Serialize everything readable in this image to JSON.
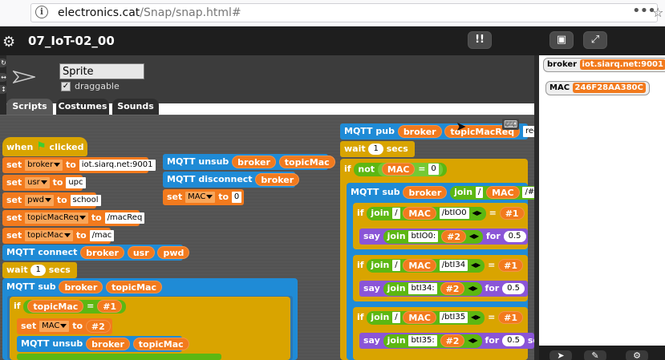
{
  "browser": {
    "url_host": "electronics.cat",
    "url_path": "/Snap/snap.html#",
    "menu_glyph": "•••",
    "star_glyph": "☆"
  },
  "toolbar": {
    "project_title": "07_IoT-02_00",
    "gear_glyph": "⚙",
    "cloud_glyph": "!!",
    "stage_glyph": "▣",
    "fullscreen_glyph": "⤢"
  },
  "palette_controls": [
    "↻",
    "↔",
    "↕"
  ],
  "sprite": {
    "name": "Sprite",
    "draggable_label": "draggable",
    "draggable_checked": "✓"
  },
  "tabs": [
    "Scripts",
    "Costumes",
    "Sounds"
  ],
  "scripts": {
    "hat": {
      "when": "when",
      "clicked": "clicked"
    },
    "set_label": "set",
    "to_label": "to",
    "sets": [
      {
        "var": "broker",
        "value": "iot.siarq.net:9001"
      },
      {
        "var": "usr",
        "value": "upc"
      },
      {
        "var": "pwd",
        "value": "school"
      },
      {
        "var": "topicMacReq",
        "value": "/macReq"
      },
      {
        "var": "topicMac",
        "value": "/mac"
      }
    ],
    "connect": {
      "label": "MQTT connect",
      "args": [
        "broker",
        "usr",
        "pwd"
      ]
    },
    "wait": {
      "label": "wait",
      "value": "1",
      "unit": "secs"
    },
    "sub": {
      "label": "MQTT sub",
      "args": [
        "broker",
        "topicMac"
      ]
    },
    "if_label": "if",
    "eq": "=",
    "if1": {
      "var": "topicMac",
      "value": "#1"
    },
    "set_mac": {
      "var": "MAC",
      "value": "#2"
    },
    "unsub_inner": {
      "label": "MQTT unsub",
      "args": [
        "broker",
        "topicMac"
      ]
    },
    "script2": {
      "unsub": {
        "label": "MQTT unsub",
        "args": [
          "broker",
          "topicMac"
        ]
      },
      "disconnect": {
        "label": "MQTT disconnect",
        "arg": "broker"
      },
      "set": {
        "var": "MAC",
        "value": "0"
      }
    },
    "script3": {
      "pub": {
        "label": "MQTT pub",
        "args": [
          "broker",
          "topicMacReq"
        ],
        "tail": "req"
      },
      "wait": {
        "label": "wait",
        "value": "1",
        "unit": "secs"
      },
      "not": "not",
      "mac_var": "MAC",
      "zero": "0",
      "sub": {
        "label": "MQTT sub",
        "arg": "broker",
        "join": "join",
        "slash": "/",
        "hash": "/#"
      },
      "join": "join",
      "say": "say",
      "for": "for",
      "hash1": "#1",
      "hash2": "#2",
      "duration": "0.5",
      "branches": [
        {
          "topic": "/btIO0",
          "prefix": "btIO0:"
        },
        {
          "topic": "/btI34",
          "prefix": "btI34:"
        },
        {
          "topic": "/btI35",
          "prefix": "btI35:"
        }
      ],
      "trail": "se"
    }
  },
  "stage": {
    "watchers": [
      {
        "label": "broker",
        "value": "iot.siarq.net:9001"
      },
      {
        "label": "MAC",
        "value": "246F28AA380C"
      }
    ],
    "bottom_buttons": [
      "➤",
      "✎",
      "⚙"
    ]
  },
  "colors": {
    "control": "#d9a400",
    "variables": "#f27a1d",
    "network": "#1f8bd6",
    "operators": "#5cb712",
    "looks": "#8a55d7"
  }
}
